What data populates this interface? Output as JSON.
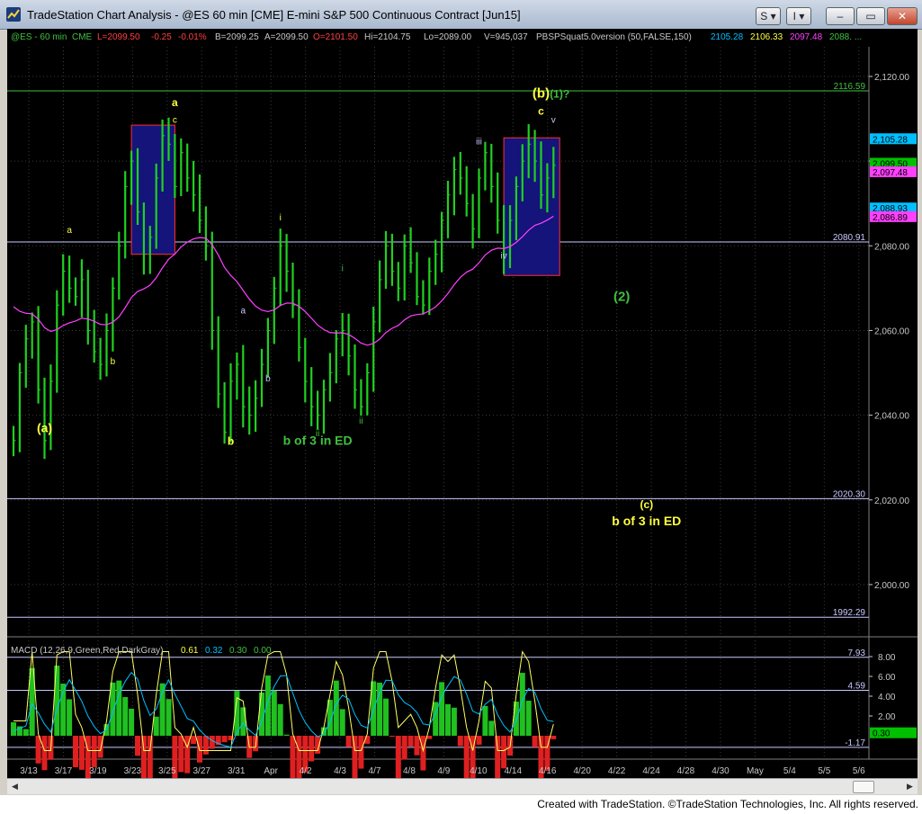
{
  "window": {
    "title": "TradeStation Chart Analysis - @ES 60 min [CME] E-mini S&P 500 Continuous Contract [Jun15]",
    "buttons": {
      "s": "S",
      "i": "I",
      "dropdown": "▾",
      "minimize": "–",
      "restore": "▭",
      "close": "✕"
    }
  },
  "header": {
    "symbol": "@ES - 60 min",
    "exchange": "CME",
    "last": "L=2099.50",
    "change": "-0.25",
    "pct": "-0.01%",
    "bid": "B=2099.25",
    "ask": "A=2099.50",
    "open": "O=2101.50",
    "high": "Hi=2104.75",
    "low": "Lo=2089.00",
    "volume": "V=945,037",
    "study": "PBSPSquat5.0version (50,FALSE,150)",
    "study_vals": [
      "2105.28",
      "2106.33",
      "2097.48",
      "2088. ..."
    ]
  },
  "price_axis": {
    "ticks": [
      "2,120.00",
      "2,100.00",
      "2,080.00",
      "2,060.00",
      "2,040.00",
      "2,020.00",
      "2,000.00"
    ],
    "range": [
      1990,
      2127
    ]
  },
  "levels": [
    {
      "label": "2116.59",
      "value": 2116.59,
      "color": "#40c040"
    },
    {
      "label": "2080.91",
      "value": 2080.91,
      "color": "#c8c8ff"
    },
    {
      "label": "2020.30",
      "value": 2020.3,
      "color": "#c8c8ff"
    },
    {
      "label": "1992.29",
      "value": 1992.29,
      "color": "#c8c8ff"
    }
  ],
  "price_tags": [
    {
      "label": "2,105.28",
      "value": 2105.28,
      "bg": "#00c0ff",
      "fg": "#000000"
    },
    {
      "label": "2,099.50",
      "value": 2099.5,
      "bg": "#00c000",
      "fg": "#000000"
    },
    {
      "label": "2,097.48",
      "value": 2097.48,
      "bg": "#ff40ff",
      "fg": "#000000"
    },
    {
      "label": "2,088.93",
      "value": 2088.93,
      "bg": "#00c0ff",
      "fg": "#000000"
    },
    {
      "label": "2,086.89",
      "value": 2086.89,
      "bg": "#ff40ff",
      "fg": "#000000"
    }
  ],
  "annotations": [
    {
      "text": "(a)",
      "color": "#ffff40",
      "size": 14,
      "price": 2036,
      "bar": 5
    },
    {
      "text": "a",
      "color": "#ffff40",
      "size": 10,
      "price": 2083,
      "bar": 9
    },
    {
      "text": "b",
      "color": "#ffff40",
      "size": 10,
      "price": 2052,
      "bar": 16
    },
    {
      "text": "a",
      "color": "#ffff40",
      "size": 12,
      "price": 2113,
      "bar": 26
    },
    {
      "text": "c",
      "color": "#ffff40",
      "size": 10,
      "price": 2109,
      "bar": 26
    },
    {
      "text": "b",
      "color": "#ffff40",
      "size": 12,
      "price": 2033,
      "bar": 35
    },
    {
      "text": "a",
      "color": "#c8c8ff",
      "size": 10,
      "price": 2064,
      "bar": 37
    },
    {
      "text": "b",
      "color": "#c8c8ff",
      "size": 10,
      "price": 2048,
      "bar": 41
    },
    {
      "text": "i",
      "color": "#ffff40",
      "size": 10,
      "price": 2086,
      "bar": 43
    },
    {
      "text": "i",
      "color": "#40c040",
      "size": 10,
      "price": 2074,
      "bar": 53
    },
    {
      "text": "ii",
      "color": "#40c040",
      "size": 10,
      "price": 2035,
      "bar": 49
    },
    {
      "text": "b of 3 in ED",
      "color": "#40c040",
      "size": 14,
      "price": 2033,
      "bar": 49
    },
    {
      "text": "ii",
      "color": "#40c040",
      "size": 10,
      "price": 2038,
      "bar": 56
    },
    {
      "text": "iii",
      "color": "#c8c8ff",
      "size": 10,
      "price": 2104,
      "bar": 75
    },
    {
      "text": "iv",
      "color": "#c8c8ff",
      "size": 10,
      "price": 2077,
      "bar": 79
    },
    {
      "text": "(b)",
      "color": "#ffff40",
      "size": 15,
      "price": 2115,
      "bar": 85
    },
    {
      "text": "(1)?",
      "color": "#40c040",
      "size": 12,
      "price": 2115,
      "bar": 88
    },
    {
      "text": "c",
      "color": "#ffff40",
      "size": 12,
      "price": 2111,
      "bar": 85
    },
    {
      "text": "v",
      "color": "#c8c8ff",
      "size": 10,
      "price": 2109,
      "bar": 87
    },
    {
      "text": "(2)",
      "color": "#40c040",
      "size": 15,
      "price": 2067,
      "bar": 98
    },
    {
      "text": "(c)",
      "color": "#ffff40",
      "size": 12,
      "price": 2018,
      "bar": 102
    },
    {
      "text": "b of 3 in ED",
      "color": "#ffff40",
      "size": 14,
      "price": 2014,
      "bar": 102
    }
  ],
  "boxes": [
    {
      "bar_from": 19,
      "bar_to": 26,
      "price_from": 2078,
      "price_to": 2108.5
    },
    {
      "bar_from": 79,
      "bar_to": 88,
      "price_from": 2073,
      "price_to": 2105.5
    }
  ],
  "bars": [
    2034,
    2050,
    2058,
    2062,
    2046,
    2034,
    2048,
    2066,
    2074,
    2070,
    2068,
    2072,
    2060,
    2055,
    2052,
    2060,
    2070,
    2080,
    2094,
    2100,
    2088,
    2078,
    2082,
    2096,
    2106,
    2104,
    2094,
    2102,
    2096,
    2092,
    2086,
    2080,
    2060,
    2045,
    2036,
    2048,
    2052,
    2042,
    2040,
    2044,
    2052,
    2060,
    2070,
    2080,
    2074,
    2066,
    2056,
    2048,
    2042,
    2040,
    2046,
    2050,
    2058,
    2060,
    2054,
    2046,
    2042,
    2050,
    2062,
    2072,
    2080,
    2074,
    2070,
    2080,
    2076,
    2068,
    2066,
    2074,
    2078,
    2086,
    2092,
    2098,
    2096,
    2090,
    2084,
    2096,
    2102,
    2094,
    2086,
    2078,
    2086,
    2094,
    2100,
    2104,
    2100,
    2092,
    2096,
    2099
  ],
  "macd": {
    "legend": "MACD (12,26,9,Green,Red,DarkGray)",
    "values": [
      "0.61",
      "0.32",
      "0.30",
      "0.00"
    ],
    "value_colors": [
      "#ffff40",
      "#00c0ff",
      "#40c040",
      "#40c040"
    ],
    "ticks": [
      "8.00",
      "6.00",
      "4.00",
      "2.00"
    ],
    "levels": [
      {
        "label": "7.93",
        "value": 7.93
      },
      {
        "label": "4.59",
        "value": 4.59
      },
      {
        "label": "-1.17",
        "value": -1.17
      }
    ],
    "last_tag": "0.30",
    "range": [
      -2,
      9
    ]
  },
  "dates": [
    "3/13",
    "3/17",
    "3/19",
    "3/23",
    "3/25",
    "3/27",
    "3/31",
    "Apr",
    "4/2",
    "4/3",
    "4/7",
    "4/8",
    "4/9",
    "4/10",
    "4/14",
    "4/16",
    "4/20",
    "4/22",
    "4/24",
    "4/28",
    "4/30",
    "May",
    "5/4",
    "5/5",
    "5/6"
  ],
  "footer": "Created with TradeStation. ©TradeStation Technologies, Inc. All rights reserved."
}
